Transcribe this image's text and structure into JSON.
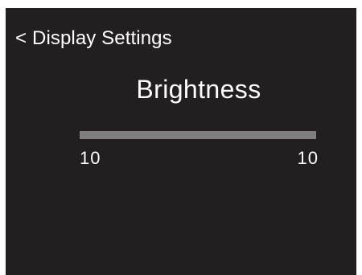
{
  "header": {
    "back_icon": "<",
    "back_label": "Display Settings"
  },
  "page": {
    "title": "Brightness"
  },
  "brightness_slider": {
    "min_label": "10",
    "max_label": "10",
    "level_fraction": 1.0
  },
  "colors": {
    "screen_background": "#231f20",
    "text": "#ffffff",
    "slider_track": "#7f7f80"
  }
}
